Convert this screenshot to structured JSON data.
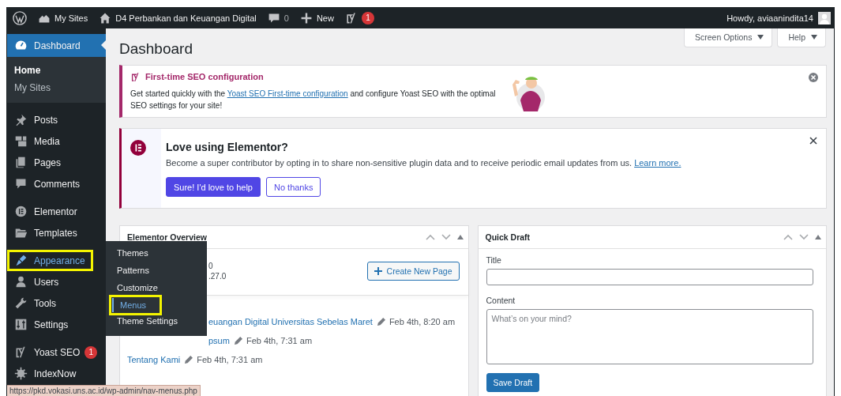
{
  "admin_bar": {
    "items": [
      {
        "kind": "logo"
      },
      {
        "kind": "sites",
        "label": "My Sites"
      },
      {
        "kind": "home",
        "label": "D4 Perbankan dan Keuangan Digital"
      },
      {
        "kind": "comments",
        "label": "0"
      },
      {
        "kind": "new",
        "label": "New"
      },
      {
        "kind": "yoast",
        "badge": "1"
      }
    ],
    "account": "Howdy, aviaanindita14"
  },
  "sidebar": {
    "groups": [
      [
        {
          "kind": "dashboard",
          "label": "Dashboard",
          "selected": true,
          "children": [
            {
              "label": "Home",
              "selected": true
            },
            {
              "label": "My Sites",
              "selected": false
            }
          ]
        }
      ],
      [
        {
          "kind": "posts",
          "label": "Posts",
          "selected": false
        },
        {
          "kind": "media",
          "label": "Media",
          "selected": false
        },
        {
          "kind": "pages",
          "label": "Pages",
          "selected": false
        },
        {
          "kind": "comments",
          "label": "Comments",
          "selected": false
        }
      ],
      [
        {
          "kind": "elementor",
          "label": "Elementor",
          "selected": false
        },
        {
          "kind": "templates",
          "label": "Templates",
          "selected": false
        }
      ],
      [
        {
          "kind": "appearance",
          "label": "Appearance",
          "selected": false,
          "hovered": true,
          "annotated": true,
          "flyout": [
            {
              "label": "Themes",
              "selected": false,
              "annotated": false
            },
            {
              "label": "Patterns",
              "selected": false,
              "annotated": false
            },
            {
              "label": "Customize",
              "selected": false,
              "annotated": false
            },
            {
              "label": "Menus",
              "selected": true,
              "annotated": true
            },
            {
              "label": "Theme Settings",
              "selected": false,
              "annotated": false
            }
          ]
        },
        {
          "kind": "users",
          "label": "Users",
          "selected": false
        },
        {
          "kind": "tools",
          "label": "Tools",
          "selected": false
        },
        {
          "kind": "settings",
          "label": "Settings",
          "selected": false
        }
      ],
      [
        {
          "kind": "yoast",
          "label": "Yoast SEO",
          "badge": "1",
          "selected": false
        },
        {
          "kind": "indexnow",
          "label": "IndexNow",
          "selected": false
        }
      ]
    ]
  },
  "page_title": "Dashboard",
  "screen_buttons": [
    "Screen Options",
    "Help"
  ],
  "yoast_notice": {
    "title": "First-time SEO configuration",
    "text_before": "Get started quickly with the ",
    "link": "Yoast SEO First-time configuration",
    "text_after": " and configure Yoast SEO with the optimal SEO settings for your site!"
  },
  "elementor_notice": {
    "title": "Love using Elementor?",
    "text": "Become a super contributor by opting in to share non-sensitive plugin data and to receive periodic email updates from us.",
    "link": "Learn more.",
    "buttons": [
      {
        "kind": "primary",
        "label": "Sure! I'd love to help"
      },
      {
        "kind": "secondary",
        "label": "No thanks"
      }
    ]
  },
  "elementor_overview": {
    "title": "Elementor Overview",
    "version_lines": [
      "0",
      ".27.0"
    ],
    "button": "Create New Page",
    "recent": [
      {
        "title": "euangan Digital Universitas Sebelas Maret",
        "date": "Feb 4th, 8:20 am",
        "covered": true
      },
      {
        "title": "psum",
        "date": "Feb 4th, 7:31 am",
        "covered": true
      },
      {
        "title": "Tentang Kami",
        "date": "Feb 4th, 7:31 am",
        "covered": false
      }
    ]
  },
  "quick_draft": {
    "title": "Quick Draft",
    "title_label": "Title",
    "content_label": "Content",
    "content_placeholder": "What’s on your mind?",
    "button": "Save Draft"
  },
  "status_url": "https://pkd.vokasi.uns.ac.id/wp-admin/nav-menus.php"
}
